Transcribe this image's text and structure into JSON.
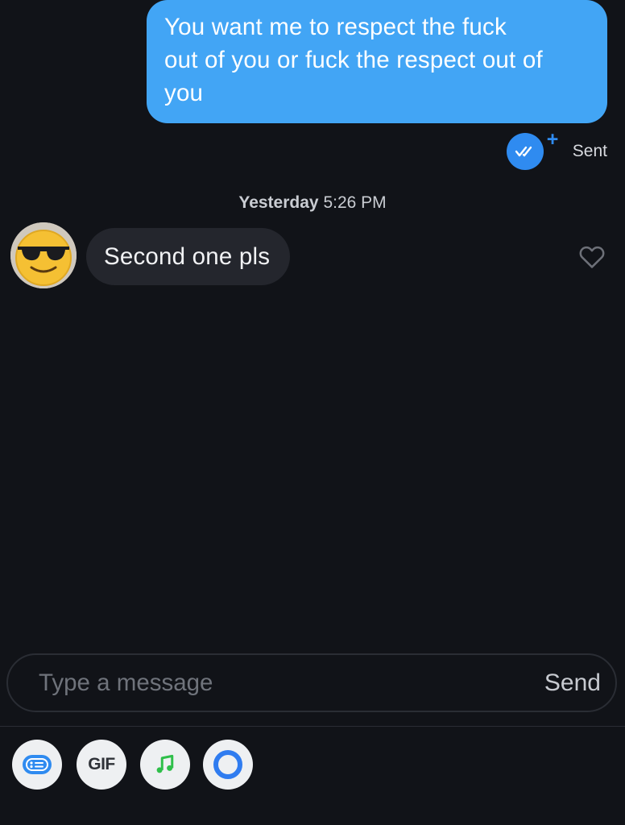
{
  "conversation": {
    "outgoing_message": {
      "lines": [
        "You want me to respect the fuck",
        "out of you or fuck the respect out of",
        "you"
      ],
      "status": "Sent",
      "status_icon": "double-check-icon",
      "status_extra_icon": "plus-icon"
    },
    "timestamp": {
      "day": "Yesterday",
      "time": "5:26 PM"
    },
    "incoming_message": {
      "avatar": "sunglasses-emoji-avatar",
      "text": "Second one pls",
      "reaction_icon": "heart-outline-icon"
    }
  },
  "composer": {
    "placeholder": "Type a message",
    "value": "",
    "send_label": "Send"
  },
  "toolbar": {
    "items": [
      {
        "name": "sticker-icon",
        "label": ""
      },
      {
        "name": "gif-button",
        "label": "GIF"
      },
      {
        "name": "music-note-icon",
        "label": ""
      },
      {
        "name": "ring-icon",
        "label": ""
      }
    ]
  },
  "colors": {
    "background": "#111318",
    "outgoing_bubble": "#42a5f5",
    "incoming_bubble": "#24262d",
    "accent": "#2f8bf0",
    "music_green": "#2fbf4a"
  }
}
